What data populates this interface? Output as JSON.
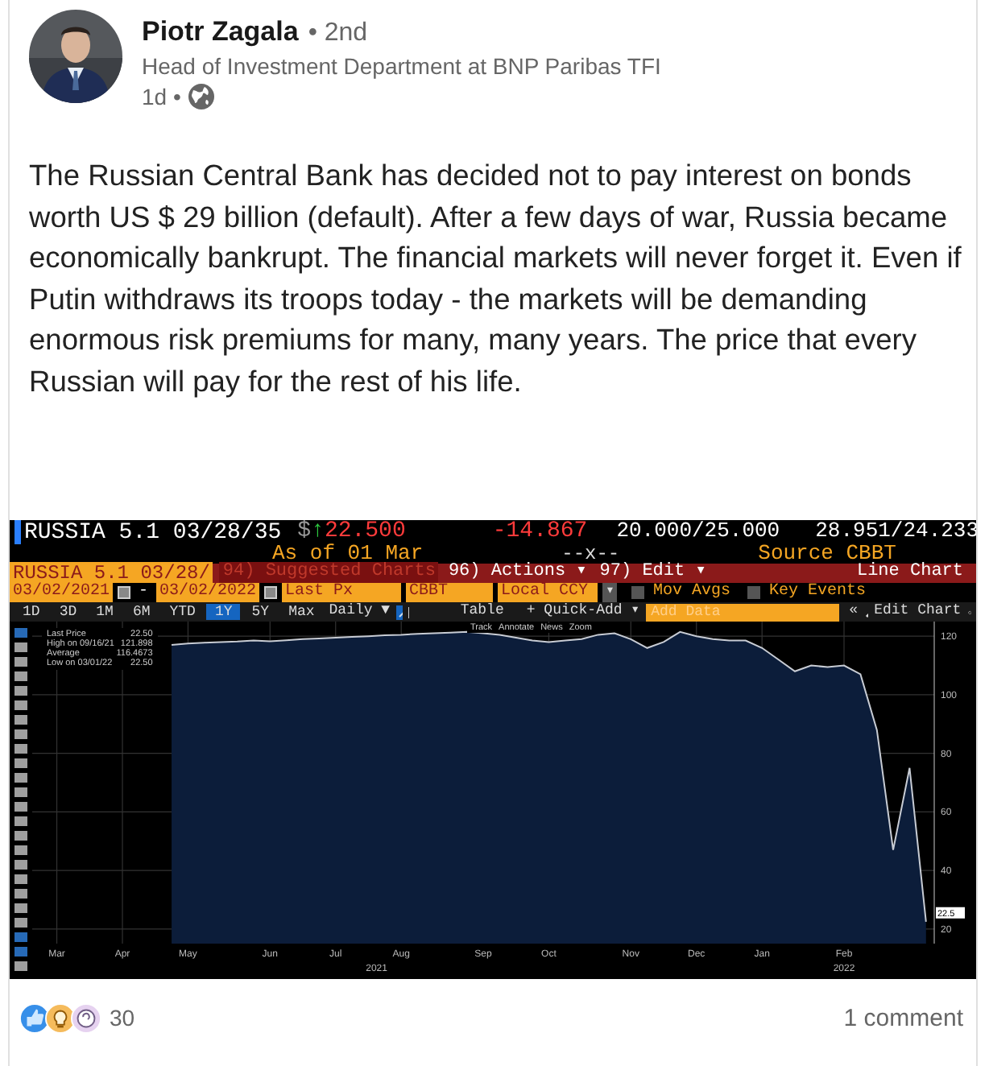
{
  "post": {
    "author": "Piotr Zagala",
    "degree": "• 2nd",
    "headline": "Head of Investment Department at BNP Paribas TFI",
    "time": "1d •",
    "text": "The Russian Central Bank has decided not to pay interest on bonds worth US $ 29 billion (default). After a few days of war, Russia became economically bankrupt. The financial markets will never forget it. Even if Putin withdraws its troops today - the markets will be demanding enormous risk premiums for many, many years. The price that every Russian will pay for the rest of his life."
  },
  "terminal": {
    "ticker_bar": {
      "security": "RUSSIA 5.1 03/28/35",
      "currency": "$",
      "change_arrow": "↑",
      "price": "22.500",
      "change": "-14.867",
      "bid_ask_size": "20.000/25.000",
      "yields": "28.951/24.233",
      "as_of": "As of 01 Mar",
      "marker": "--x--",
      "source": "Source CBBT"
    },
    "menu_bar": {
      "security_field": "RUSSIA 5.1 03/28/",
      "items": [
        {
          "label": "94) Suggested Charts",
          "kind": "dim"
        },
        {
          "label": "96) Actions ▾",
          "kind": "menu"
        },
        {
          "label": "97) Edit ▾",
          "kind": "menu"
        }
      ],
      "title": "Line Chart"
    },
    "settings_bar": {
      "start_date": "03/02/2021",
      "separator": "-",
      "end_date": "03/02/2022",
      "field": "Last Px",
      "source": "CBBT",
      "currency": "Local CCY",
      "dropdown": "▾",
      "toggles": [
        {
          "label": "Mov Avgs",
          "checked": false
        },
        {
          "label": "Key Events",
          "checked": false
        }
      ]
    },
    "range_bar": {
      "ranges": [
        {
          "label": "1D",
          "selected": false
        },
        {
          "label": "3D",
          "selected": false
        },
        {
          "label": "1M",
          "selected": false
        },
        {
          "label": "6M",
          "selected": false
        },
        {
          "label": "YTD",
          "selected": false
        },
        {
          "label": "1Y",
          "selected": true
        },
        {
          "label": "5Y",
          "selected": false
        },
        {
          "label": "Max",
          "selected": false
        }
      ],
      "frequency": "Daily ▼",
      "table": "Table",
      "quick_add": "+ Quick-Add ▾",
      "add_data_placeholder": "Add Data",
      "collapse": "«",
      "edit_chart": "Edit Chart"
    },
    "chart_tools": [
      "Track",
      "Annotate",
      "News",
      "Zoom"
    ],
    "legend": [
      {
        "kind": "series",
        "value": "22.50"
      },
      {
        "kind": "stat",
        "label": "High on 09/16/21",
        "value": "121.898"
      },
      {
        "kind": "stat",
        "label": "Average",
        "value": "116.4673"
      },
      {
        "kind": "stat",
        "label": "Low on 03/01/22",
        "value": "22.50"
      }
    ],
    "last_price_tag": "22.5",
    "chart_data": {
      "type": "area",
      "grid": true,
      "categories": [
        null,
        "Mar",
        null,
        null,
        null,
        "Apr",
        null,
        null,
        null,
        "May",
        null,
        null,
        null,
        null,
        "Jun",
        null,
        null,
        null,
        "Jul",
        null,
        null,
        null,
        "Aug",
        null,
        null,
        null,
        null,
        "Sep",
        null,
        null,
        null,
        "Oct",
        null,
        null,
        null,
        null,
        "Nov",
        null,
        null,
        null,
        "Dec",
        null,
        null,
        null,
        "Jan",
        null,
        null,
        null,
        null,
        "Feb",
        null,
        null,
        null,
        null,
        null
      ],
      "annotations": [
        "2021",
        "2022"
      ],
      "series": [
        {
          "name": "Last Price",
          "color": "#c8ccd4",
          "values": [
            null,
            null,
            null,
            null,
            null,
            null,
            null,
            null,
            117,
            117.5,
            117.8,
            118,
            118.2,
            118.5,
            118.3,
            118.6,
            119,
            119.2,
            119.5,
            119.8,
            120,
            120.3,
            120.5,
            120.8,
            121,
            121.2,
            121.5,
            121,
            120.5,
            119.5,
            118.5,
            118,
            118.5,
            119,
            120.5,
            121,
            119,
            116,
            118,
            121.5,
            120,
            119,
            118.5,
            118.5,
            116,
            112,
            108,
            110,
            109.5,
            110,
            107,
            88,
            47,
            75,
            22.5
          ]
        }
      ],
      "yticks": [
        20,
        40,
        60,
        80,
        100,
        120
      ],
      "ylim": [
        15,
        125
      ]
    }
  },
  "social": {
    "reactions": [
      {
        "kind": "like"
      },
      {
        "kind": "insightful"
      },
      {
        "kind": "curious"
      }
    ],
    "count": "30",
    "comments": "1 comment"
  }
}
